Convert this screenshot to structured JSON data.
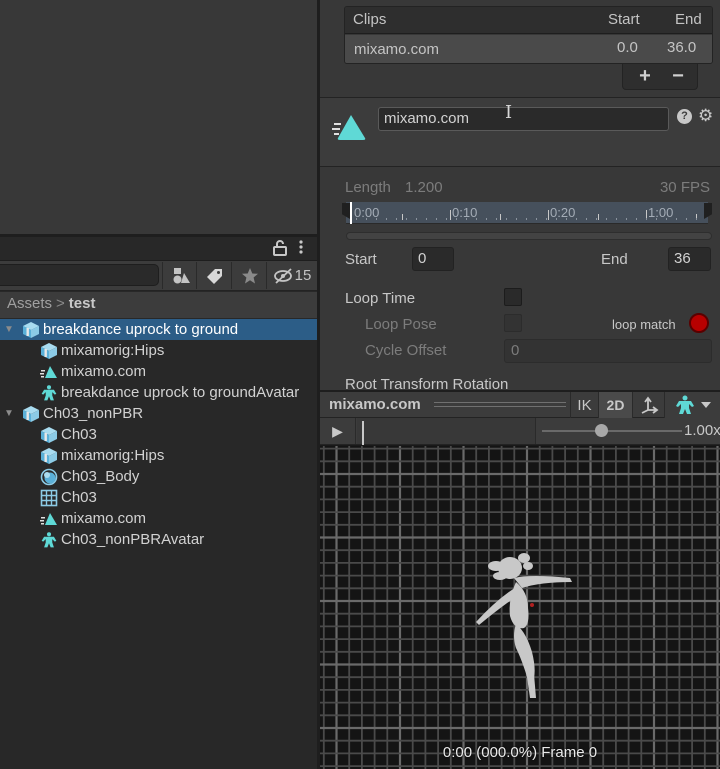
{
  "inspector": {
    "clips": {
      "header": {
        "name": "Clips",
        "start": "Start",
        "end": "End"
      },
      "rows": [
        {
          "name": "mixamo.com",
          "start": "0.0",
          "end": "36.0"
        }
      ],
      "add_label": "+",
      "remove_label": "−"
    },
    "clip_name": "mixamo.com",
    "length_label": "Length",
    "length_value": "1.200",
    "fps_label": "30 FPS",
    "ruler_labels": [
      "0:00",
      "0:10",
      "0:20",
      "1:00"
    ],
    "start_label": "Start",
    "start_value": "0",
    "end_label": "End",
    "end_value": "36",
    "loop_time_label": "Loop Time",
    "loop_time_checked": false,
    "loop_pose_label": "Loop Pose",
    "loop_pose_checked": false,
    "loop_match_label": "loop match",
    "loop_match_color": "#b80000",
    "cycle_offset_label": "Cycle Offset",
    "cycle_offset_value": "0",
    "root_transform_label": "Root Transform Rotation",
    "help_icon": "?",
    "gear_icon": "⚙"
  },
  "preview": {
    "title": "mixamo.com",
    "ik_label": "IK",
    "twod_label": "2D",
    "play_icon": "▶",
    "speed_value": "1.00x",
    "speed_fraction": 0.42,
    "status": "0:00 (000.0%) Frame 0"
  },
  "project": {
    "lock_icon": "lock-open",
    "hidden_count": "15",
    "breadcrumb": {
      "root": "Assets",
      "separator": ">",
      "current": "test"
    },
    "tree": [
      {
        "label": "breakdance uprock to ground",
        "icon": "model-prefab",
        "level": 0,
        "expanded": true,
        "selected": true
      },
      {
        "label": "mixamorig:Hips",
        "icon": "model-prefab",
        "level": 1
      },
      {
        "label": "mixamo.com",
        "icon": "animation-clip",
        "level": 1
      },
      {
        "label": "breakdance uprock to groundAvatar",
        "icon": "avatar",
        "level": 1
      },
      {
        "label": "Ch03_nonPBR",
        "icon": "model-prefab",
        "level": 0,
        "expanded": true,
        "selected": false
      },
      {
        "label": "Ch03",
        "icon": "model-prefab",
        "level": 1
      },
      {
        "label": "mixamorig:Hips",
        "icon": "model-prefab",
        "level": 1
      },
      {
        "label": "Ch03_Body",
        "icon": "material",
        "level": 1
      },
      {
        "label": "Ch03",
        "icon": "mesh",
        "level": 1
      },
      {
        "label": "mixamo.com",
        "icon": "animation-clip",
        "level": 1
      },
      {
        "label": "Ch03_nonPBRAvatar",
        "icon": "avatar",
        "level": 1
      }
    ]
  },
  "colors": {
    "accent_cyan": "#5fd9d6",
    "selection": "#2c5d87"
  }
}
